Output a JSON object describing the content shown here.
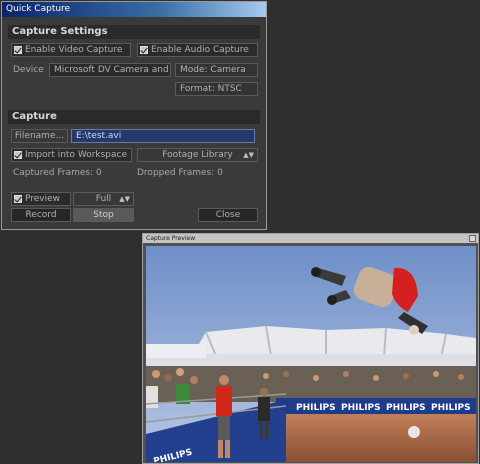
{
  "quick_capture": {
    "title": "Quick Capture",
    "settings_header": "Capture Settings",
    "enable_video": "Enable Video Capture",
    "enable_audio": "Enable Audio Capture",
    "device_label": "Device",
    "device_value": "Microsoft DV Camera and Vi",
    "mode_label": "Mode: Camera",
    "format_label": "Format: NTSC",
    "capture_header": "Capture",
    "filename_button": "Filename...",
    "filename_value": "E:\\test.avi",
    "import_workspace": "Import into Workspace",
    "footage_library": "Footage Library",
    "captured_frames": "Captured Frames: 0",
    "dropped_frames": "Dropped Frames: 0",
    "preview_label": "Preview",
    "preview_size": "Full",
    "record_button": "Record",
    "stop_button": "Stop",
    "close_button": "Close"
  },
  "capture_preview": {
    "title": "Capture Preview",
    "banner_text": [
      "PHILIPS",
      "PHILIPS",
      "PHILIPS",
      "PHILIPS"
    ],
    "side_banner_text": "PHILIPS"
  }
}
